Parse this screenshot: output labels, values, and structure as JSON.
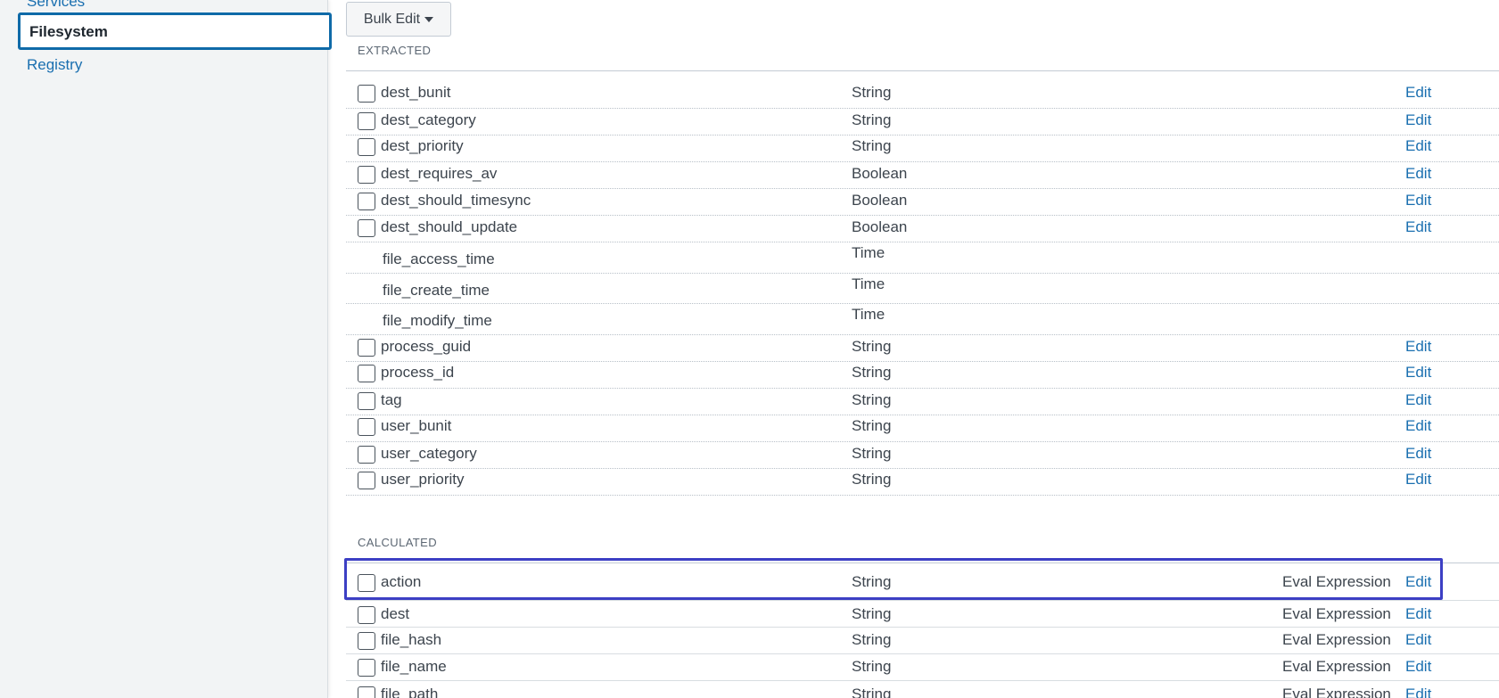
{
  "sidebar": {
    "items": [
      {
        "label": "Services"
      },
      {
        "label": "Filesystem"
      },
      {
        "label": "Registry"
      }
    ]
  },
  "toolbar": {
    "bulk_edit_label": "Bulk Edit"
  },
  "sections": {
    "extracted": {
      "title": "EXTRACTED",
      "rows": [
        {
          "name": "dest_bunit",
          "type": "String",
          "checkbox": true,
          "edit": "Edit"
        },
        {
          "name": "dest_category",
          "type": "String",
          "checkbox": true,
          "edit": "Edit"
        },
        {
          "name": "dest_priority",
          "type": "String",
          "checkbox": true,
          "edit": "Edit"
        },
        {
          "name": "dest_requires_av",
          "type": "Boolean",
          "checkbox": true,
          "edit": "Edit"
        },
        {
          "name": "dest_should_timesync",
          "type": "Boolean",
          "checkbox": true,
          "edit": "Edit"
        },
        {
          "name": "dest_should_update",
          "type": "Boolean",
          "checkbox": true,
          "edit": "Edit"
        },
        {
          "name": "file_access_time",
          "type": "Time",
          "checkbox": false,
          "edit": ""
        },
        {
          "name": "file_create_time",
          "type": "Time",
          "checkbox": false,
          "edit": ""
        },
        {
          "name": "file_modify_time",
          "type": "Time",
          "checkbox": false,
          "edit": ""
        },
        {
          "name": "process_guid",
          "type": "String",
          "checkbox": true,
          "edit": "Edit"
        },
        {
          "name": "process_id",
          "type": "String",
          "checkbox": true,
          "edit": "Edit"
        },
        {
          "name": "tag",
          "type": "String",
          "checkbox": true,
          "edit": "Edit"
        },
        {
          "name": "user_bunit",
          "type": "String",
          "checkbox": true,
          "edit": "Edit"
        },
        {
          "name": "user_category",
          "type": "String",
          "checkbox": true,
          "edit": "Edit"
        },
        {
          "name": "user_priority",
          "type": "String",
          "checkbox": true,
          "edit": "Edit"
        }
      ]
    },
    "calculated": {
      "title": "CALCULATED",
      "rows": [
        {
          "name": "action",
          "type": "String",
          "kind": "Eval Expression",
          "checkbox": true,
          "edit": "Edit"
        },
        {
          "name": "dest",
          "type": "String",
          "kind": "Eval Expression",
          "checkbox": true,
          "edit": "Edit"
        },
        {
          "name": "file_hash",
          "type": "String",
          "kind": "Eval Expression",
          "checkbox": true,
          "edit": "Edit"
        },
        {
          "name": "file_name",
          "type": "String",
          "kind": "Eval Expression",
          "checkbox": true,
          "edit": "Edit"
        },
        {
          "name": "file_path",
          "type": "String",
          "kind": "Eval Expression",
          "checkbox": true,
          "edit": "Edit"
        }
      ]
    }
  },
  "colors": {
    "link": "#1a6fb0",
    "highlight": "#3c3fc4",
    "selected_border": "#0f6aa8"
  }
}
